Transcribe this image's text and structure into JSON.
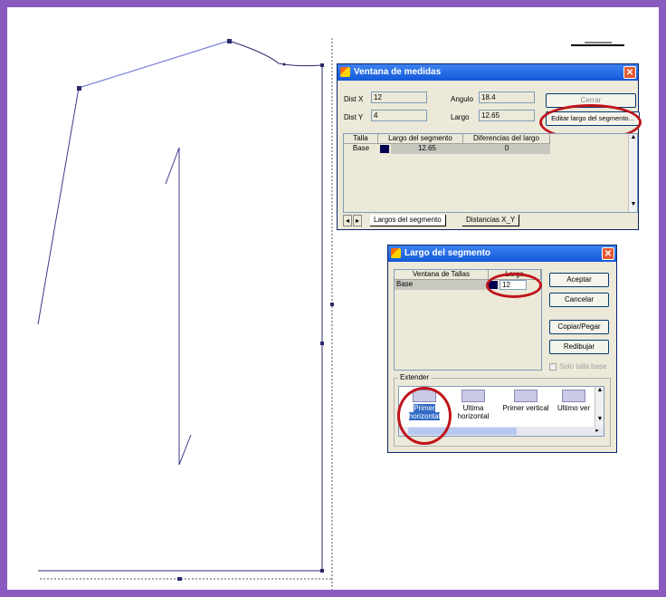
{
  "measures_window": {
    "title": "Ventana de medidas",
    "dist_x_label": "Dist X",
    "dist_x_value": "12",
    "dist_y_label": "Dist Y",
    "dist_y_value": "4",
    "angle_label": "Angulo",
    "angle_value": "18.4",
    "length_label": "Largo",
    "length_value": "12.65",
    "top_button_label": "Cerrar",
    "edit_button_label": "Editar largo del segmento...",
    "table": {
      "headers": [
        "Talla",
        "Largo del segmento",
        "Diferencias del largo"
      ],
      "rows": [
        {
          "size": "Base",
          "segment_length": "12.65",
          "difference": "0"
        }
      ]
    },
    "tabs": [
      "Largos del segmento",
      "Distancias X_Y"
    ]
  },
  "segment_window": {
    "title": "Largo del segmento",
    "grid_headers": [
      "Ventana de Tallas",
      "Largo"
    ],
    "grid_rows": [
      {
        "size": "Base",
        "value": "12"
      }
    ],
    "buttons": {
      "accept": "Aceptar",
      "cancel": "Cancelar",
      "copy_paste": "Copiar/Pegar",
      "redraw": "Redibujar"
    },
    "base_only_label": "Solo talla base",
    "extend_group_label": "Extender",
    "extend_options": [
      {
        "label": "Primer horizontal",
        "selected": true
      },
      {
        "label": "Ultima horizontal",
        "selected": false
      },
      {
        "label": "Primer vertical",
        "selected": false
      },
      {
        "label": "Ultimo ver",
        "selected": false
      }
    ]
  },
  "colors": {
    "border_frame": "#8a5bbf",
    "highlight_ring": "#c0141b",
    "title_bar": "#1359d8",
    "selection": "#316ac5"
  }
}
